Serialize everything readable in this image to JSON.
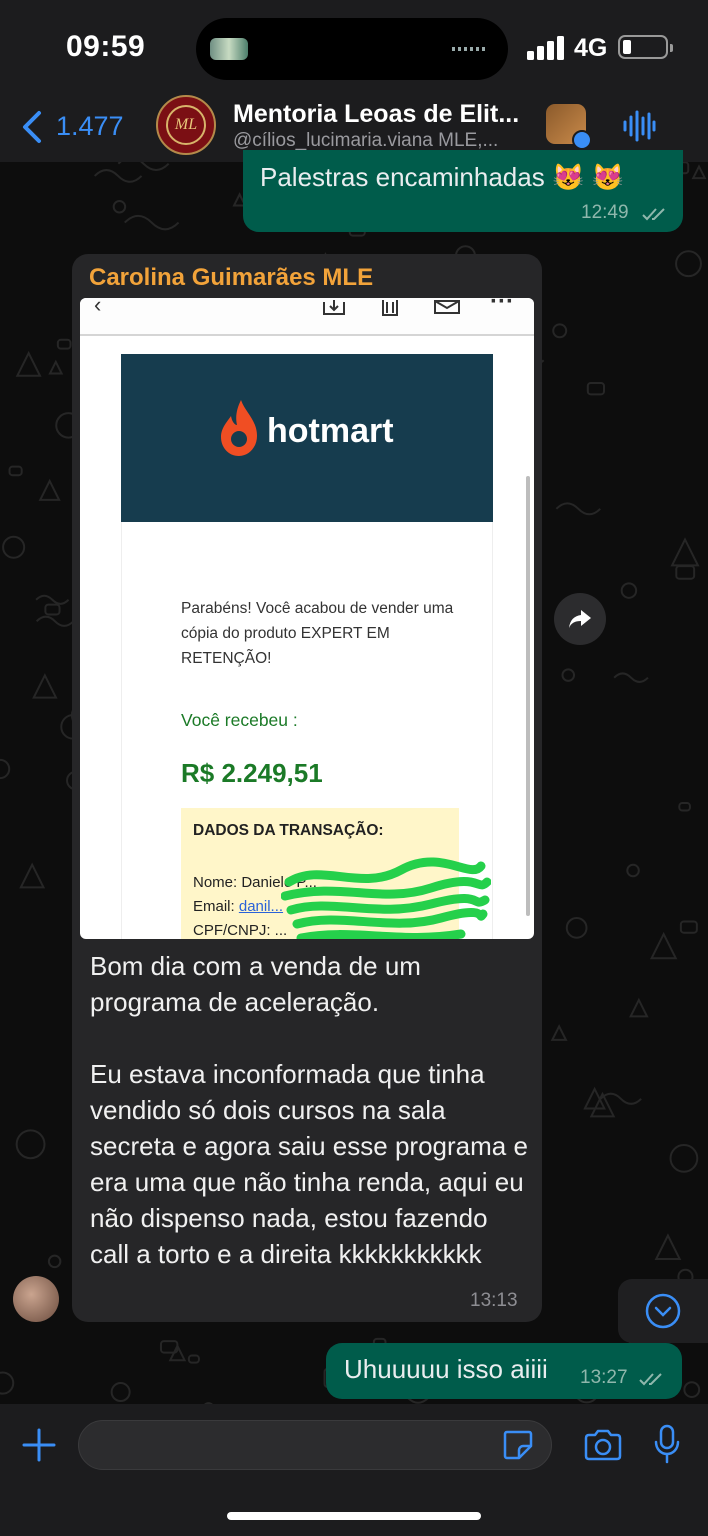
{
  "status_bar": {
    "time": "09:59",
    "network": "4G"
  },
  "header": {
    "back_count": "1.477",
    "title": "Mentoria Leoas de Elit...",
    "subtitle": "@cílios_lucimaria.viana MLE,...",
    "avatar_monogram": "ML"
  },
  "messages": {
    "outgoing_1": {
      "text": "Palestras encaminhadas 😻 😻",
      "time": "12:49"
    },
    "incoming_1": {
      "sender": "Carolina Guimarães MLE",
      "time": "13:13",
      "paragraph_1": "Bom dia com a venda de um programa de aceleração.",
      "paragraph_2": "Eu estava inconformada que tinha vendido só dois cursos na sala secreta e agora saiu esse programa e era uma que não tinha renda, aqui eu não dispenso nada, estou fazendo call a torto e a direita kkkkkkkkkkk",
      "image": {
        "brand": "hotmart",
        "congrats_text": "Parabéns! Você acabou de vender uma cópia do produto EXPERT EM RETENÇÃO!",
        "received_label": "Você recebeu :",
        "amount": "R$ 2.249,51",
        "transaction_title": "DADOS DA TRANSAÇÃO:",
        "name_label": "Nome: Danielo P...",
        "email_label": "Email:",
        "email_value": "danil...",
        "cpf_label": "CPF/CNPJ: ..."
      }
    },
    "outgoing_2": {
      "text": "Uhuuuuu isso aiiii",
      "time": "13:27"
    }
  },
  "colors": {
    "outgoing_bubble": "#005c4b",
    "incoming_bubble": "#262628",
    "sender_name": "#f2a33a",
    "accent_blue": "#3a8ef6",
    "hotmart_banner": "#163c4e",
    "hotmart_flame": "#f04e23",
    "money_green": "#1b7a27"
  },
  "icons": [
    "back-chevron-icon",
    "audio-waveform-icon",
    "forward-icon",
    "scroll-down-icon",
    "plus-icon",
    "sticker-icon",
    "camera-icon",
    "microphone-icon",
    "read-receipt-icon"
  ]
}
